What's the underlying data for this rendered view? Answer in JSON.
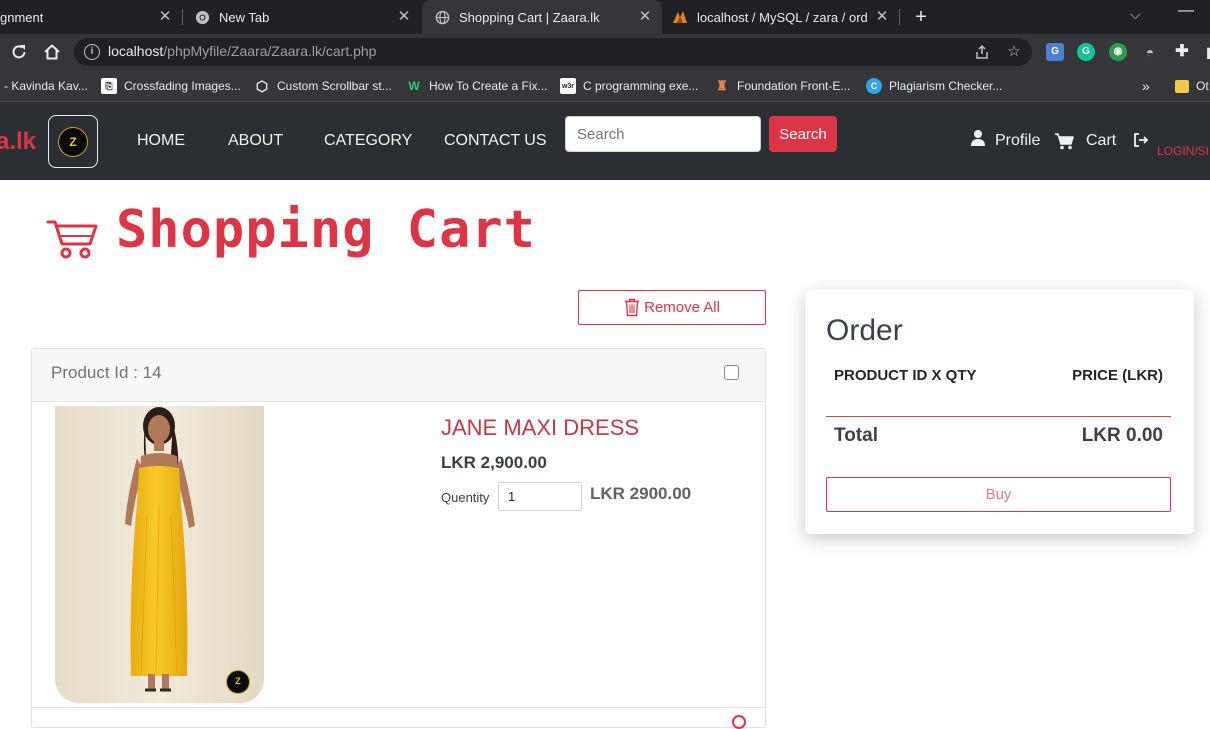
{
  "browser": {
    "tabs": [
      {
        "title": "gnment",
        "active": false,
        "icon": "none"
      },
      {
        "title": "New Tab",
        "active": false,
        "icon": "chrome-icon"
      },
      {
        "title": "Shopping Cart | Zaara.lk",
        "active": true,
        "icon": "globe-icon"
      },
      {
        "title": "localhost / MySQL / zara / order...",
        "active": false,
        "icon": "phpmyadmin-icon"
      }
    ],
    "address": {
      "host": "localhost",
      "path": "/phpMyfile/Zaara/Zaara.lk/cart.php"
    },
    "bookmarks": [
      {
        "label": "- Kavinda Kav...",
        "icon": "none"
      },
      {
        "label": "Crossfading Images...",
        "icon": "css-icon"
      },
      {
        "label": "Custom Scrollbar st...",
        "icon": "codepen-icon"
      },
      {
        "label": "How To Create a Fix...",
        "icon": "w3-icon"
      },
      {
        "label": "C programming exe...",
        "icon": "w3resource-icon"
      },
      {
        "label": "Foundation Front-E...",
        "icon": "foundation-icon"
      },
      {
        "label": "Plagiarism Checker...",
        "icon": "plagiarism-icon"
      },
      {
        "label": "Ot",
        "icon": "folder-icon"
      }
    ]
  },
  "site": {
    "brand": "a.lk",
    "logo_text": "Z",
    "nav": [
      "HOME",
      "ABOUT",
      "CATEGORY",
      "CONTACT US"
    ],
    "search": {
      "placeholder": "Search",
      "button_label": "Search"
    },
    "profile_label": "Profile",
    "cart_label": "Cart",
    "login_label": "LOGIN/SI"
  },
  "page": {
    "heading": "Shopping Cart",
    "remove_all_label": "Remove All"
  },
  "cart_items": [
    {
      "product_id_label": "Product Id : 14",
      "name": "JANE MAXI DRESS",
      "price": "LKR 2,900.00",
      "quantity_label": "Quentity",
      "quantity": "1",
      "line_total": "LKR 2900.00",
      "badge": "Z"
    }
  ],
  "order": {
    "title": "Order",
    "col_left": "PRODUCT ID X QTY",
    "col_right": "PRICE (LKR)",
    "total_label": "Total",
    "total_value": "LKR 0.00",
    "buy_label": "Buy"
  },
  "colors": {
    "accent": "#dc3545",
    "navbar_bg": "#2b2f33",
    "browser_frame": "#202124",
    "dress": "#f4bf1f"
  }
}
